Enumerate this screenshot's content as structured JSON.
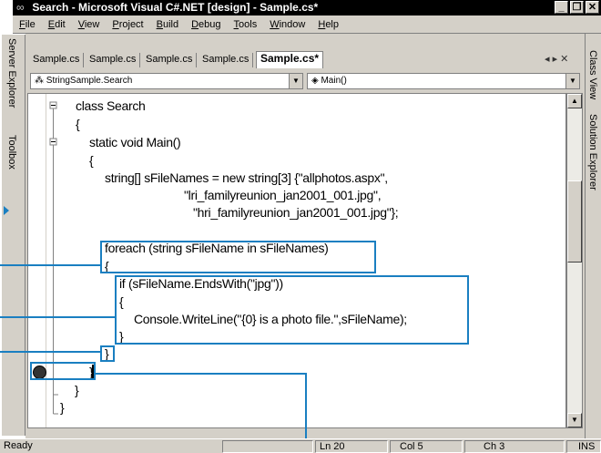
{
  "title": {
    "icon_glyph": "∞",
    "text": "Search - Microsoft Visual C#.NET [design] - Sample.cs*",
    "minimize": "_",
    "restore": "❐",
    "close": "✕"
  },
  "menu": [
    "File",
    "Edit",
    "View",
    "Project",
    "Build",
    "Debug",
    "Tools",
    "Window",
    "Help"
  ],
  "left_tabs": [
    "Server Explorer",
    "Toolbox"
  ],
  "right_tabs": [
    "Class View",
    "Solution Explorer"
  ],
  "doc_tabs": [
    "Sample.cs",
    "Sample.cs",
    "Sample.cs",
    "Sample.cs",
    "Sample.cs*"
  ],
  "tab_nav": "◂ ▸ ✕",
  "class_combo": "StringSample.Search",
  "member_combo": "Main()",
  "code": {
    "l1": "class Search",
    "l2": "{",
    "l3": "static void Main()",
    "l4": "{",
    "l5": "string[] sFileNames = new string[3] {\"allphotos.aspx\",",
    "l6": "\"lri_familyreunion_jan2001_001.jpg\",",
    "l7": "\"hri_familyreunion_jan2001_001.jpg\"};",
    "l8": "foreach (string sFileName in sFileNames)",
    "l9": "{",
    "l10": "if (sFileName.EndsWith(\"jpg\"))",
    "l11": "{",
    "l12": "Console.WriteLine(\"{0} is a photo file.\",sFileName);",
    "l13": "}",
    "l14": "}",
    "l15": "}",
    "l16": "}",
    "l17": "}"
  },
  "status": {
    "ready": "Ready",
    "ln": "Ln 20",
    "col": "Col 5",
    "ch": "Ch 3",
    "ins": "INS"
  },
  "colors": {
    "callout": "#1a7fc1",
    "chrome": "#d4d0c8",
    "titlebar": "#000000"
  }
}
